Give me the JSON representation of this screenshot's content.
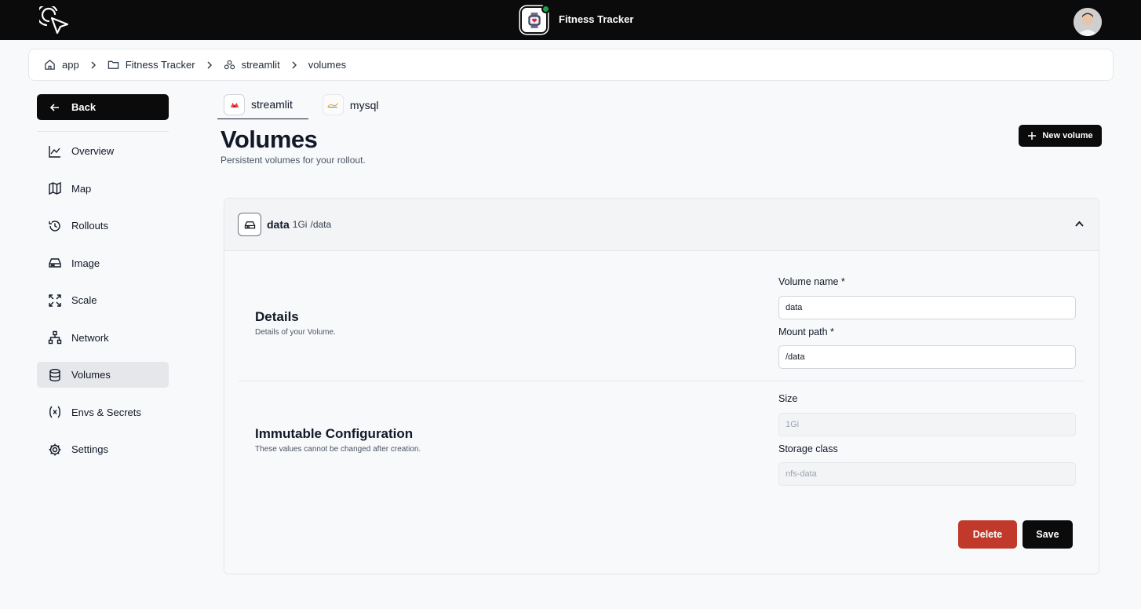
{
  "header": {
    "app_title": "Fitness Tracker",
    "logo_icon": "cursor-logo-icon",
    "status_color": "#16a34a"
  },
  "breadcrumb": [
    {
      "label": "app",
      "icon": "home-icon"
    },
    {
      "label": "Fitness Tracker",
      "icon": "folder-icon"
    },
    {
      "label": "streamlit",
      "icon": "service-icon"
    },
    {
      "label": "volumes",
      "icon": ""
    }
  ],
  "sidebar": {
    "back_label": "Back",
    "items": [
      {
        "label": "Overview",
        "icon": "chart-line-icon"
      },
      {
        "label": "Map",
        "icon": "map-icon"
      },
      {
        "label": "Rollouts",
        "icon": "history-icon"
      },
      {
        "label": "Image",
        "icon": "hard-drive-icon"
      },
      {
        "label": "Scale",
        "icon": "scale-icon"
      },
      {
        "label": "Network",
        "icon": "network-icon"
      },
      {
        "label": "Volumes",
        "icon": "database-icon",
        "active": true
      },
      {
        "label": "Envs & Secrets",
        "icon": "variable-icon"
      },
      {
        "label": "Settings",
        "icon": "gear-icon"
      }
    ]
  },
  "tabs": [
    {
      "label": "streamlit",
      "active": true
    },
    {
      "label": "mysql",
      "active": false
    }
  ],
  "page": {
    "title": "Volumes",
    "subtitle": "Persistent volumes for your rollout.",
    "new_button": "New volume"
  },
  "volume": {
    "name": "data",
    "size": "1Gi",
    "path": "/data",
    "details": {
      "title": "Details",
      "description": "Details of your Volume.",
      "name_label": "Volume name *",
      "name_value": "data",
      "path_label": "Mount path *",
      "path_value": "/data"
    },
    "immutable": {
      "title": "Immutable Configuration",
      "description": "These values cannot be changed after creation.",
      "size_label": "Size",
      "size_value": "1Gi",
      "class_label": "Storage class",
      "class_value": "nfs-data"
    },
    "delete_label": "Delete",
    "save_label": "Save",
    "delete_color": "#c0392b"
  }
}
